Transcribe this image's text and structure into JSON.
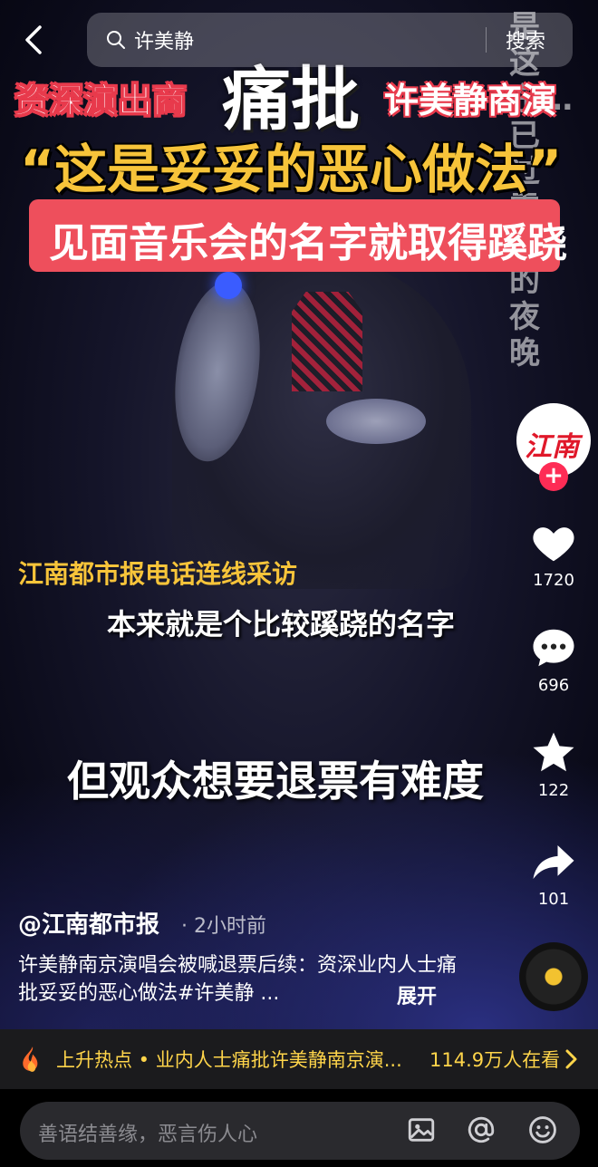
{
  "search": {
    "query": "许美静",
    "button": "搜索"
  },
  "overlay": {
    "headline_left": "资深演出商",
    "headline_big": "痛批",
    "headline_right": "许美静商演",
    "quote": "“这是妥妥的恶心做法”",
    "banner": "见面音乐会的名字就取得蹊跷",
    "vertical_text": "是这东…已过零时的夜晚"
  },
  "subtitles": {
    "source": "江南都市报电话连线采访",
    "line1": "本来就是个比较蹊跷的名字",
    "line2": "但观众想要退票有难度"
  },
  "actions": {
    "avatar_logo": "江南",
    "follow": "+",
    "likes": "1720",
    "comments": "696",
    "favorites": "122",
    "shares": "101"
  },
  "caption": {
    "author": "@江南都市报",
    "time": "· 2小时前",
    "description": "许美静南京演唱会被喊退票后续：资深业内人士痛批妥妥的恶心做法#许美静 ...",
    "expand": "展开"
  },
  "hot": {
    "text": "上升热点 • 业内人士痛批许美静南京演...",
    "viewers": "114.9万人在看"
  },
  "comment": {
    "placeholder": "善语结善缘，恶言伤人心"
  },
  "colors": {
    "accent_red": "#fe2c55",
    "headline_yellow": "#f7c43a",
    "banner_red": "#ee4f5c",
    "hot_yellow": "#ffd54a"
  }
}
